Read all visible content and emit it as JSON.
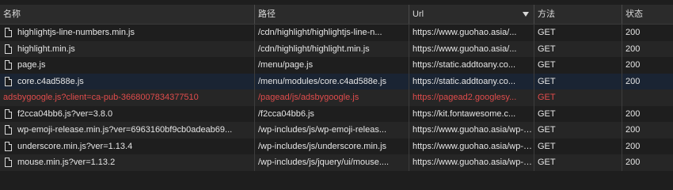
{
  "columns": {
    "name": "名称",
    "path": "路径",
    "url": "Url",
    "method": "方法",
    "status": "状态"
  },
  "colors": {
    "error_text": "#e04c4c",
    "selected_row": "#1a2433",
    "background": "#1e1e1e"
  },
  "rows": [
    {
      "name": "highlightjs-line-numbers.min.js",
      "path": "/cdn/highlight/highlightjs-line-n...",
      "url": "https://www.guohao.asia/...",
      "method": "GET",
      "status": "200",
      "icon": "file-icon"
    },
    {
      "name": "highlight.min.js",
      "path": "/cdn/highlight/highlight.min.js",
      "url": "https://www.guohao.asia/...",
      "method": "GET",
      "status": "200",
      "icon": "file-icon"
    },
    {
      "name": "page.js",
      "path": "/menu/page.js",
      "url": "https://static.addtoany.co...",
      "method": "GET",
      "status": "200",
      "icon": "file-icon"
    },
    {
      "name": "core.c4ad588e.js",
      "path": "/menu/modules/core.c4ad588e.js",
      "url": "https://static.addtoany.co...",
      "method": "GET",
      "status": "200",
      "icon": "file-icon"
    },
    {
      "name": "adsbygoogle.js?client=ca-pub-3668007834377510",
      "path": "/pagead/js/adsbygoogle.js",
      "url": "https://pagead2.googlesy...",
      "method": "GET",
      "status": "",
      "icon": ""
    },
    {
      "name": "f2cca04bb6.js?ver=3.8.0",
      "path": "/f2cca04bb6.js",
      "url": "https://kit.fontawesome.c...",
      "method": "GET",
      "status": "200",
      "icon": "file-icon"
    },
    {
      "name": "wp-emoji-release.min.js?ver=6963160bf9cb0adeab69...",
      "path": "/wp-includes/js/wp-emoji-releas...",
      "url": "https://www.guohao.asia/wp-in...",
      "method": "GET",
      "status": "200",
      "icon": "file-icon"
    },
    {
      "name": "underscore.min.js?ver=1.13.4",
      "path": "/wp-includes/js/underscore.min.js",
      "url": "https://www.guohao.asia/wp-in...",
      "method": "GET",
      "status": "200",
      "icon": "file-icon"
    },
    {
      "name": "mouse.min.js?ver=1.13.2",
      "path": "/wp-includes/js/jquery/ui/mouse....",
      "url": "https://www.guohao.asia/wp-in...",
      "method": "GET",
      "status": "200",
      "icon": "file-icon"
    }
  ]
}
